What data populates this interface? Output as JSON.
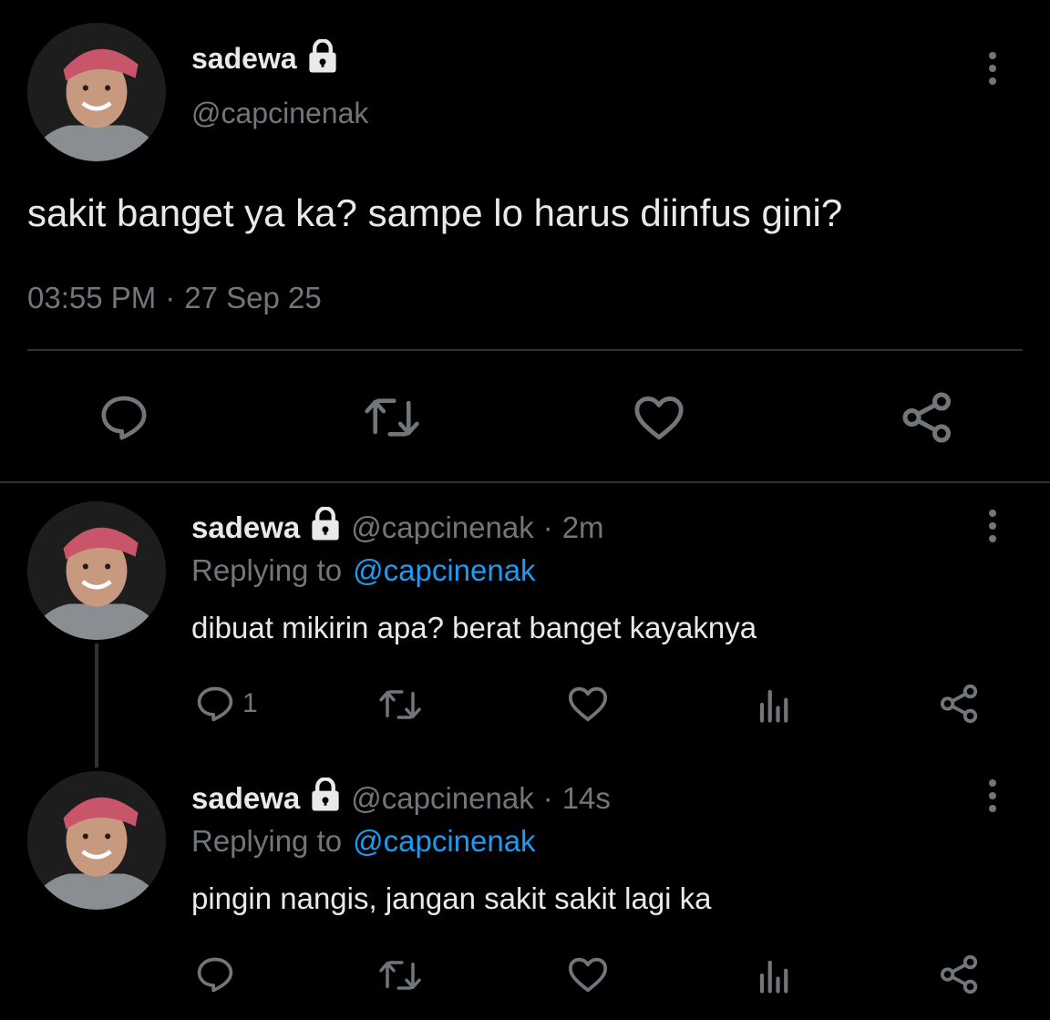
{
  "main_tweet": {
    "display_name": "sadewa",
    "handle": "@capcinenak",
    "text": "sakit banget ya ka? sampe lo harus diinfus gini?",
    "time": "03:55 PM",
    "separator": "·",
    "date": "27 Sep 25",
    "actions": [
      "reply-icon",
      "retweet-icon",
      "like-icon",
      "share-icon"
    ]
  },
  "replies": [
    {
      "display_name": "sadewa",
      "handle": "@capcinenak",
      "separator": "·",
      "age": "2m",
      "replying_label": "Replying to",
      "replying_to": "@capcinenak",
      "text": "dibuat mikirin apa? berat banget kayaknya",
      "reply_count": "1"
    },
    {
      "display_name": "sadewa",
      "handle": "@capcinenak",
      "separator": "·",
      "age": "14s",
      "replying_label": "Replying to",
      "replying_to": "@capcinenak",
      "text": "pingin nangis, jangan sakit sakit lagi ka",
      "reply_count": ""
    }
  ],
  "colors": {
    "background": "#000000",
    "text": "#e7e9ea",
    "muted": "#71767b",
    "link": "#1d9bf0",
    "divider": "#2f3336"
  }
}
